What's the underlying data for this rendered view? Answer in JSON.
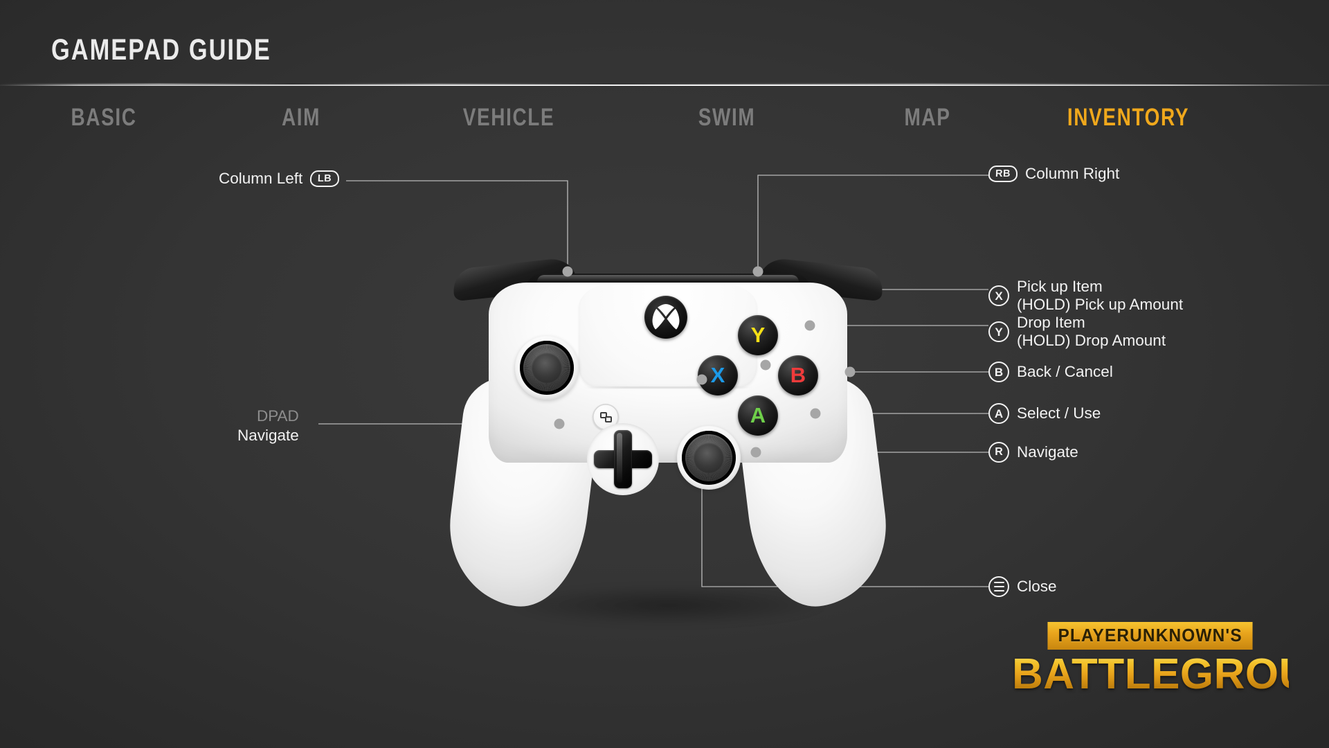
{
  "header": {
    "title": "GAMEPAD GUIDE"
  },
  "tabs": [
    {
      "label": "BASIC",
      "active": false
    },
    {
      "label": "AIM",
      "active": false
    },
    {
      "label": "VEHICLE",
      "active": false
    },
    {
      "label": "SWIM",
      "active": false
    },
    {
      "label": "MAP",
      "active": false
    },
    {
      "label": "INVENTORY",
      "active": true
    }
  ],
  "colors": {
    "accent": "#f0a81c",
    "tab_inactive": "#7c7c7c",
    "text": "#f2f2f2",
    "dim_text": "#8d8d8d",
    "background": "#333333",
    "button_y": "#f5e016",
    "button_x": "#1c9ae8",
    "button_b": "#ef3b3b",
    "button_a": "#6fd04a"
  },
  "callouts": {
    "column_left": {
      "label": "Column Left",
      "badge": "LB",
      "badge_icon": "bumper-lb-icon"
    },
    "column_right": {
      "label": "Column Right",
      "badge": "RB",
      "badge_icon": "bumper-rb-icon"
    },
    "pick_up": {
      "badge": "X",
      "line1": "Pick up Item",
      "line2": "(HOLD) Pick up Amount"
    },
    "drop": {
      "badge": "Y",
      "line1": "Drop Item",
      "line2": "(HOLD) Drop Amount"
    },
    "back": {
      "badge": "B",
      "line1": "Back / Cancel"
    },
    "select": {
      "badge": "A",
      "line1": "Select / Use"
    },
    "navigate_stick": {
      "badge": "R",
      "line1": "Navigate"
    },
    "dpad": {
      "label": "DPAD",
      "line1": "Navigate"
    },
    "close": {
      "badge_icon": "hamburger-menu-icon",
      "line1": "Close"
    }
  },
  "controller": {
    "face_buttons": {
      "y": "Y",
      "x": "X",
      "b": "B",
      "a": "A"
    },
    "guide_icon": "xbox-logo-icon",
    "view_icon": "view-button-icon",
    "menu_icon": "menu-button-icon",
    "dpad_icon": "dpad-icon",
    "left_stick_icon": "left-analog-stick-icon",
    "right_stick_icon": "right-analog-stick-icon"
  },
  "brand": {
    "top": "PLAYERUNKNOWN'S",
    "bottom": "BATTLEGROUNDS"
  }
}
